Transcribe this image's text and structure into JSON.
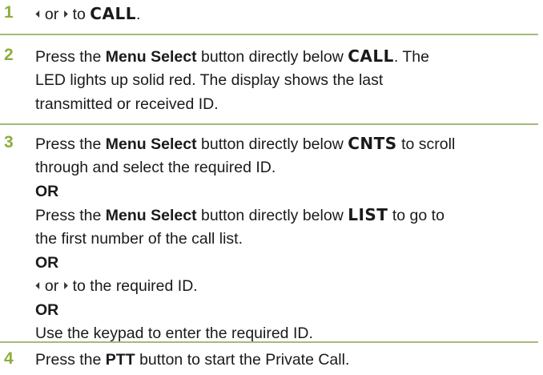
{
  "steps": [
    {
      "number": "1",
      "arrow_left": "⏴",
      "or": "or",
      "arrow_right": "⏵",
      "to": "to",
      "display_call": "CALL",
      "end": "."
    },
    {
      "number": "2",
      "press": "Press the",
      "menu_select": "Menu Select",
      "below": "button directly below",
      "display_call": "CALL",
      "rest_line1": ". The",
      "line2": "LED lights up solid red. The display shows the last",
      "line3": "transmitted or received ID."
    },
    {
      "number": "3",
      "a_press": "Press the",
      "a_menu_select": "Menu Select",
      "a_below": "button directly below",
      "a_display": "CNTS",
      "a_rest": "to scroll",
      "a_line2": "through and select the required ID.",
      "or1": "OR",
      "b_press": "Press the",
      "b_menu_select": "Menu Select",
      "b_below": "button directly below",
      "b_display": "LIST",
      "b_rest": "to go to",
      "b_line2": "the first number of the call list.",
      "or2": "OR",
      "c_arrow_left": "⏴",
      "c_or": "or",
      "c_arrow_right": "⏵",
      "c_rest": "to the required ID.",
      "or3": "OR",
      "d_line": "Use the keypad to enter the required ID."
    },
    {
      "number": "4",
      "press": "Press the",
      "ptt": "PTT",
      "rest": "button to start the Private Call."
    }
  ]
}
